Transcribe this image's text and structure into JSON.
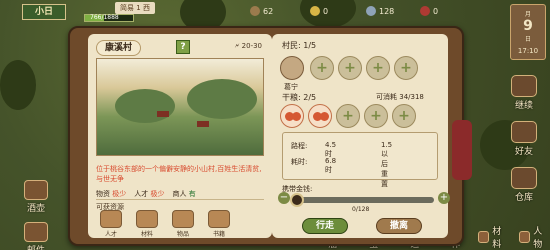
{
  "hud": {
    "village_badge": "小日",
    "level": "简易 1 西",
    "hp_text": "766/1888",
    "resources": [
      {
        "name": "food-icon",
        "value": "62",
        "color": "#9b7b4d"
      },
      {
        "name": "coin-icon",
        "value": "0",
        "color": "#d7b546"
      },
      {
        "name": "gem-icon",
        "value": "128",
        "color": "#8fa3b8"
      },
      {
        "name": "energy-icon",
        "value": "0",
        "color": "#ae3a33"
      }
    ],
    "calendar": {
      "month": "月",
      "day": "9",
      "unit": "日",
      "time": "17:10"
    }
  },
  "left_menu": [
    {
      "label": "酒壶",
      "icon": "jar-icon"
    },
    {
      "label": "邮件",
      "icon": "mail-icon"
    }
  ],
  "right_menu": [
    {
      "label": "继续",
      "icon": "hoe-icon"
    },
    {
      "label": "好友",
      "icon": "friends-icon"
    },
    {
      "label": "仓库",
      "icon": "house-icon"
    }
  ],
  "bottom_bar": [
    {
      "label": "神庙",
      "icon": "temple-icon"
    },
    {
      "label": "弟宝",
      "icon": "bag-icon"
    },
    {
      "label": "建造",
      "icon": "hammer-icon"
    },
    {
      "label": "制作",
      "icon": "craft-icon"
    },
    {
      "label": "材料",
      "icon": "box-icon"
    },
    {
      "label": "人物",
      "icon": "person-icon"
    }
  ],
  "village": {
    "title": "康溪村",
    "help": "?",
    "range": "20-30",
    "description": "位于桃谷东部的一个偏僻安静的小山村,百姓生活清贫,与世无争",
    "traits": [
      {
        "label": "物资",
        "value": "极少",
        "status": "poor"
      },
      {
        "label": "人才",
        "value": "极少",
        "status": "poor"
      },
      {
        "label": "商人",
        "value": "有",
        "status": "ok"
      }
    ],
    "resources_label": "可获资源",
    "resources": [
      {
        "label": "人才",
        "icon": "talent-icon"
      },
      {
        "label": "材料",
        "icon": "material-icon"
      },
      {
        "label": "物品",
        "icon": "item-icon"
      },
      {
        "label": "书籍",
        "icon": "book-icon"
      }
    ]
  },
  "expedition": {
    "villagers_label": "村民:",
    "villagers_count": "1/5",
    "villager_name": "葛宁",
    "food_label": "干粮:",
    "food_count": "2/5",
    "capacity_label": "可消耗",
    "capacity_value": "34/318",
    "distance_label": "路程:",
    "distance_value": "4.5时",
    "distance_bonus": "1.5以后重置",
    "time_label": "耗时:",
    "time_value": "6.8时",
    "slider_label": "携带金钱:",
    "slider_value": "0/128",
    "slider_fraction": 0,
    "go_button": "行走",
    "cancel_button": "撤离"
  }
}
